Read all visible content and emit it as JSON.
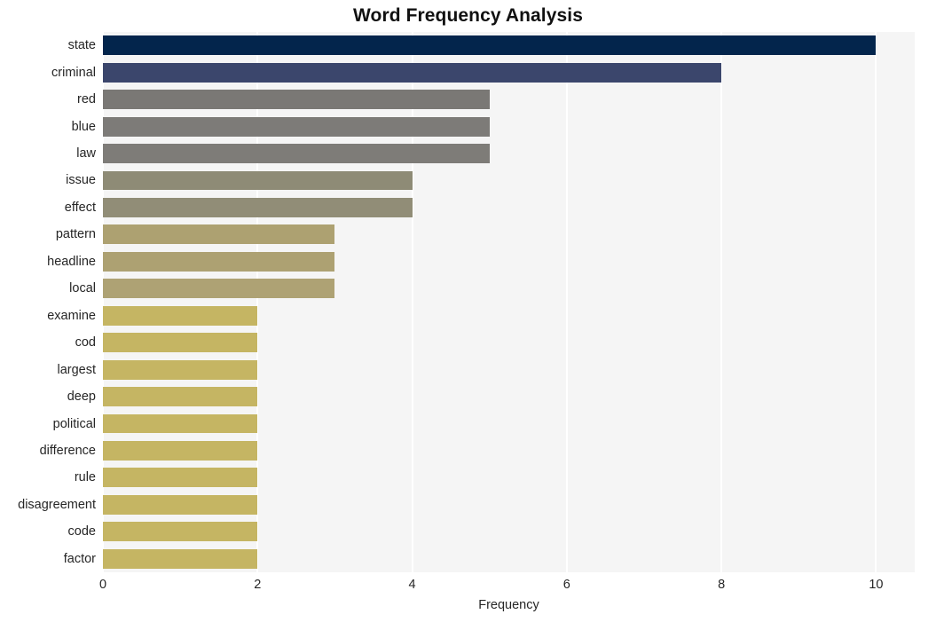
{
  "chart_data": {
    "type": "bar",
    "orientation": "horizontal",
    "title": "Word Frequency Analysis",
    "xlabel": "Frequency",
    "ylabel": "",
    "xlim": [
      0,
      10.5
    ],
    "xticks": [
      0,
      2,
      4,
      6,
      8,
      10
    ],
    "xtick_labels": [
      "0",
      "2",
      "4",
      "6",
      "8",
      "10"
    ],
    "grid": true,
    "grid_axis": "x",
    "grid_color": "#ffffff",
    "plot_background": "#f5f5f5",
    "figure_background": "#ffffff",
    "legend": null,
    "categories": [
      "state",
      "criminal",
      "red",
      "blue",
      "law",
      "issue",
      "effect",
      "pattern",
      "headline",
      "local",
      "examine",
      "cod",
      "largest",
      "deep",
      "political",
      "difference",
      "rule",
      "disagreement",
      "code",
      "factor"
    ],
    "values": [
      10,
      8,
      5,
      5,
      5,
      4,
      4,
      3,
      3,
      3,
      2,
      2,
      2,
      2,
      2,
      2,
      2,
      2,
      2,
      2
    ],
    "bar_colors": [
      "#03254c",
      "#3b466c",
      "#7a7875",
      "#7d7b78",
      "#7e7c78",
      "#8e8b76",
      "#918d77",
      "#ada171",
      "#ada172",
      "#aea274",
      "#c5b563",
      "#c5b563",
      "#c5b563",
      "#c5b563",
      "#c5b563",
      "#c5b563",
      "#c5b563",
      "#c5b563",
      "#c5b563",
      "#c5b563"
    ],
    "bars": [
      {
        "label": "state",
        "value": 10,
        "color": "#03254c"
      },
      {
        "label": "criminal",
        "value": 8,
        "color": "#3b466c"
      },
      {
        "label": "red",
        "value": 5,
        "color": "#7a7875"
      },
      {
        "label": "blue",
        "value": 5,
        "color": "#7d7b78"
      },
      {
        "label": "law",
        "value": 5,
        "color": "#7e7c78"
      },
      {
        "label": "issue",
        "value": 4,
        "color": "#8e8b76"
      },
      {
        "label": "effect",
        "value": 4,
        "color": "#918d77"
      },
      {
        "label": "pattern",
        "value": 3,
        "color": "#ada171"
      },
      {
        "label": "headline",
        "value": 3,
        "color": "#ada172"
      },
      {
        "label": "local",
        "value": 3,
        "color": "#aea274"
      },
      {
        "label": "examine",
        "value": 2,
        "color": "#c5b563"
      },
      {
        "label": "cod",
        "value": 2,
        "color": "#c5b563"
      },
      {
        "label": "largest",
        "value": 2,
        "color": "#c5b563"
      },
      {
        "label": "deep",
        "value": 2,
        "color": "#c5b563"
      },
      {
        "label": "political",
        "value": 2,
        "color": "#c5b563"
      },
      {
        "label": "difference",
        "value": 2,
        "color": "#c5b563"
      },
      {
        "label": "rule",
        "value": 2,
        "color": "#c5b563"
      },
      {
        "label": "disagreement",
        "value": 2,
        "color": "#c5b563"
      },
      {
        "label": "code",
        "value": 2,
        "color": "#c5b563"
      },
      {
        "label": "factor",
        "value": 2,
        "color": "#c5b563"
      }
    ]
  }
}
